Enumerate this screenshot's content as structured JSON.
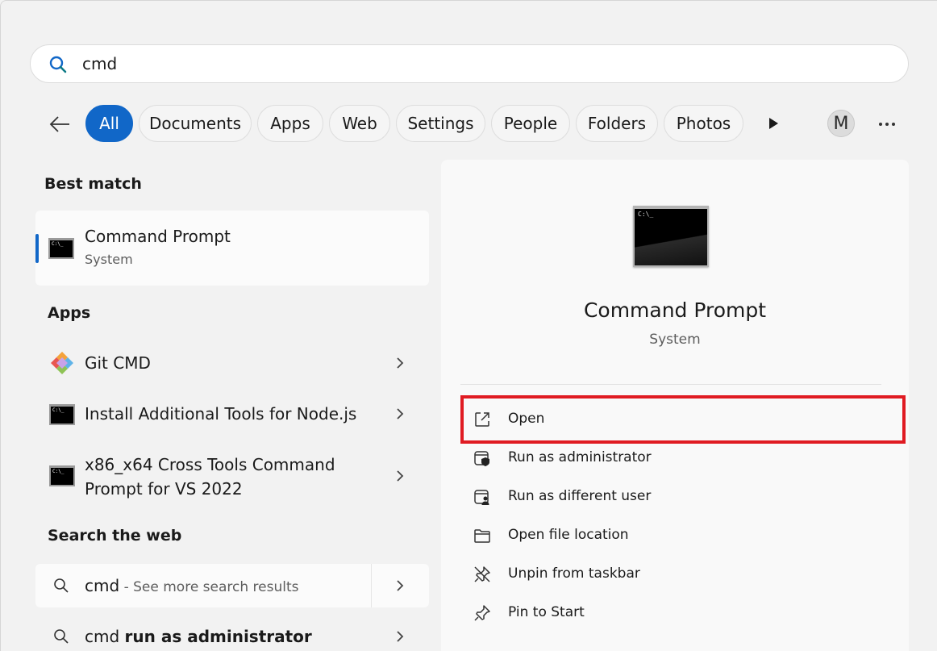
{
  "search": {
    "query": "cmd"
  },
  "filters": [
    "All",
    "Documents",
    "Apps",
    "Web",
    "Settings",
    "People",
    "Folders",
    "Photos"
  ],
  "avatar_initial": "M",
  "sections": {
    "best_match": "Best match",
    "apps": "Apps",
    "search_web": "Search the web"
  },
  "best_match": {
    "title": "Command Prompt",
    "subtitle": "System"
  },
  "apps": [
    {
      "title": "Git CMD"
    },
    {
      "title": "Install Additional Tools for Node.js"
    },
    {
      "title_line1": "x86_x64 Cross Tools Command",
      "title_line2": "Prompt for VS 2022"
    }
  ],
  "web_results": [
    {
      "term": "cmd",
      "hint": " - See more search results"
    },
    {
      "term": "cmd ",
      "bold": "run as administrator"
    }
  ],
  "detail": {
    "title": "Command Prompt",
    "subtitle": "System",
    "icon_text": "C:\\_",
    "actions": [
      {
        "label": "Open",
        "icon": "open-external-icon"
      },
      {
        "label": "Run as administrator",
        "icon": "shield-admin-icon"
      },
      {
        "label": "Run as different user",
        "icon": "user-switch-icon"
      },
      {
        "label": "Open file location",
        "icon": "folder-icon"
      },
      {
        "label": "Unpin from taskbar",
        "icon": "unpin-icon"
      },
      {
        "label": "Pin to Start",
        "icon": "pin-icon"
      }
    ]
  },
  "colors": {
    "accent": "#1167c8",
    "highlight": "#e01b22"
  }
}
